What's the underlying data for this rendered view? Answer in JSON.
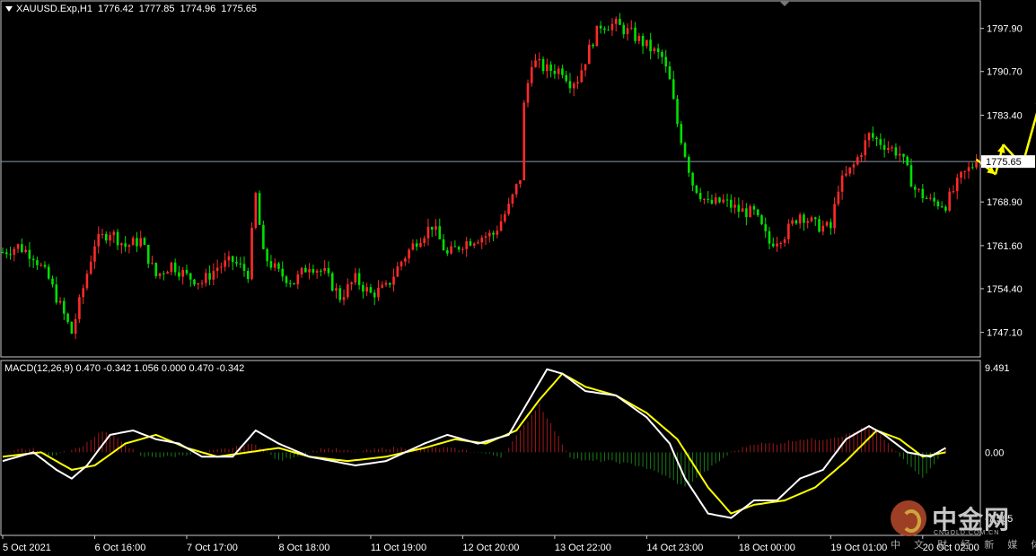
{
  "header": {
    "symbol": "XAUUSD.Exp,H1",
    "open": "1776.42",
    "high": "1777.85",
    "low": "1774.96",
    "close": "1775.65"
  },
  "macd_header": "MACD(12,26,9) 0.470 -0.342 1.056 0.000 0.470 -0.342",
  "current_price_label": "1775.65",
  "watermark": {
    "brand_cn": "中金网",
    "brand_en": "CNGOLD.COM.CN",
    "tagline": "中 文 财 经 新 媒 体"
  },
  "colors": {
    "bull": "#ff2a2a",
    "bear": "#00e000",
    "macd_line": "#ffffff",
    "signal_line": "#ffff00",
    "hist_up": "#a01818",
    "hist_down": "#1a7a1a",
    "arrow": "#ffff00",
    "frame": "#c8c8c8"
  },
  "chart_data": [
    {
      "type": "candlestick",
      "y_ticks": [
        "1797.90",
        "1790.70",
        "1783.40",
        "1775.65",
        "1768.90",
        "1761.60",
        "1754.40",
        "1747.10"
      ],
      "ylim": [
        1743.0,
        1802.5
      ],
      "current_price": 1775.65,
      "x_labels": [
        "5 Oct 2021",
        "6 Oct 16:00",
        "7 Oct 17:00",
        "8 Oct 18:00",
        "11 Oct 19:00",
        "12 Oct 20:00",
        "13 Oct 22:00",
        "14 Oct 23:00",
        "18 Oct 00:00",
        "19 Oct 01:00",
        "20 Oct 02:00"
      ],
      "x_label_bars": [
        0,
        24,
        48,
        72,
        96,
        120,
        144,
        168,
        192,
        216,
        240
      ],
      "close_path": [
        [
          0,
          1760.5
        ],
        [
          4,
          1761.5
        ],
        [
          8,
          1760.0
        ],
        [
          12,
          1756.0
        ],
        [
          16,
          1750.0
        ],
        [
          18,
          1747.0
        ],
        [
          20,
          1752.0
        ],
        [
          24,
          1762.0
        ],
        [
          28,
          1764.0
        ],
        [
          32,
          1761.5
        ],
        [
          36,
          1762.5
        ],
        [
          40,
          1756.5
        ],
        [
          44,
          1758.5
        ],
        [
          48,
          1756.5
        ],
        [
          52,
          1755.5
        ],
        [
          56,
          1758.0
        ],
        [
          60,
          1759.0
        ],
        [
          64,
          1757.0
        ],
        [
          66,
          1770.0
        ],
        [
          68,
          1760.0
        ],
        [
          72,
          1757.0
        ],
        [
          76,
          1755.5
        ],
        [
          80,
          1758.5
        ],
        [
          84,
          1757.0
        ],
        [
          88,
          1753.0
        ],
        [
          92,
          1756.0
        ],
        [
          96,
          1753.5
        ],
        [
          100,
          1754.5
        ],
        [
          104,
          1759.0
        ],
        [
          108,
          1762.5
        ],
        [
          112,
          1765.0
        ],
        [
          116,
          1760.0
        ],
        [
          120,
          1762.0
        ],
        [
          124,
          1763.0
        ],
        [
          128,
          1763.5
        ],
        [
          132,
          1768.0
        ],
        [
          135,
          1773.0
        ],
        [
          136,
          1785.0
        ],
        [
          138,
          1792.5
        ],
        [
          142,
          1791.0
        ],
        [
          146,
          1791.0
        ],
        [
          148,
          1789.0
        ],
        [
          150,
          1789.5
        ],
        [
          154,
          1796.0
        ],
        [
          156,
          1798.5
        ],
        [
          160,
          1798.5
        ],
        [
          164,
          1797.0
        ],
        [
          168,
          1795.0
        ],
        [
          172,
          1793.0
        ],
        [
          174,
          1789.0
        ],
        [
          176,
          1782.0
        ],
        [
          180,
          1772.0
        ],
        [
          184,
          1768.5
        ],
        [
          188,
          1769.0
        ],
        [
          192,
          1767.5
        ],
        [
          196,
          1767.0
        ],
        [
          200,
          1762.0
        ],
        [
          204,
          1763.5
        ],
        [
          208,
          1767.0
        ],
        [
          212,
          1765.0
        ],
        [
          216,
          1764.5
        ],
        [
          218,
          1771.5
        ],
        [
          222,
          1775.0
        ],
        [
          226,
          1780.0
        ],
        [
          230,
          1778.5
        ],
        [
          234,
          1777.0
        ],
        [
          238,
          1771.0
        ],
        [
          242,
          1769.0
        ],
        [
          246,
          1768.5
        ],
        [
          250,
          1773.0
        ],
        [
          254,
          1775.65
        ]
      ],
      "forecast_arrows": [
        {
          "from": [
            1776.0,
            254
          ],
          "to": [
            1773.5,
            259
          ]
        },
        {
          "from": [
            1773.5,
            259
          ],
          "to": [
            1778.5,
            261
          ]
        },
        {
          "from": [
            1778.5,
            261
          ],
          "to": [
            1775.0,
            266
          ]
        },
        {
          "from": [
            1775.0,
            266
          ],
          "to": [
            1786.5,
            271
          ]
        }
      ]
    },
    {
      "type": "macd",
      "name": "MACD(12,26,9)",
      "y_ticks": [
        "9.491",
        "0.00",
        "-7.565"
      ],
      "ylim": [
        -9.5,
        10.5
      ],
      "macd": [
        [
          0,
          -1.0
        ],
        [
          8,
          0
        ],
        [
          14,
          -2.0
        ],
        [
          18,
          -3.0
        ],
        [
          22,
          -1.5
        ],
        [
          28,
          2.0
        ],
        [
          34,
          2.5
        ],
        [
          40,
          1.5
        ],
        [
          46,
          1.0
        ],
        [
          52,
          -0.5
        ],
        [
          60,
          -0.5
        ],
        [
          66,
          2.5
        ],
        [
          72,
          1.0
        ],
        [
          80,
          -0.5
        ],
        [
          86,
          -1.0
        ],
        [
          92,
          -1.5
        ],
        [
          100,
          -1.0
        ],
        [
          110,
          1.0
        ],
        [
          116,
          2.0
        ],
        [
          124,
          1.0
        ],
        [
          132,
          2.0
        ],
        [
          138,
          6.5
        ],
        [
          142,
          9.5
        ],
        [
          146,
          9.0
        ],
        [
          152,
          7.0
        ],
        [
          160,
          6.5
        ],
        [
          168,
          4.0
        ],
        [
          174,
          1.0
        ],
        [
          178,
          -3.0
        ],
        [
          184,
          -7.0
        ],
        [
          190,
          -7.5
        ],
        [
          196,
          -5.5
        ],
        [
          202,
          -5.5
        ],
        [
          208,
          -3.0
        ],
        [
          214,
          -2.0
        ],
        [
          220,
          1.5
        ],
        [
          226,
          3.0
        ],
        [
          230,
          2.0
        ],
        [
          236,
          0
        ],
        [
          242,
          -0.5
        ],
        [
          246,
          0.5
        ]
      ],
      "signal": [
        [
          0,
          -0.5
        ],
        [
          10,
          0
        ],
        [
          18,
          -2.0
        ],
        [
          24,
          -1.5
        ],
        [
          32,
          1.0
        ],
        [
          40,
          2.0
        ],
        [
          48,
          0.5
        ],
        [
          56,
          -0.5
        ],
        [
          64,
          0
        ],
        [
          72,
          0.5
        ],
        [
          80,
          -0.5
        ],
        [
          90,
          -1.0
        ],
        [
          100,
          -0.5
        ],
        [
          110,
          0.5
        ],
        [
          118,
          1.5
        ],
        [
          126,
          1.0
        ],
        [
          134,
          2.5
        ],
        [
          140,
          6.0
        ],
        [
          146,
          9.0
        ],
        [
          152,
          7.5
        ],
        [
          160,
          6.5
        ],
        [
          168,
          4.5
        ],
        [
          176,
          1.5
        ],
        [
          184,
          -4.0
        ],
        [
          190,
          -7.0
        ],
        [
          196,
          -6.0
        ],
        [
          204,
          -5.5
        ],
        [
          212,
          -4.0
        ],
        [
          220,
          -1.0
        ],
        [
          228,
          2.5
        ],
        [
          234,
          1.5
        ],
        [
          240,
          -0.5
        ],
        [
          246,
          0
        ]
      ],
      "histogram": [
        [
          0,
          0
        ],
        [
          8,
          0.5
        ],
        [
          12,
          -0.5
        ],
        [
          20,
          0.5
        ],
        [
          26,
          2.5
        ],
        [
          32,
          1.0
        ],
        [
          36,
          -0.5
        ],
        [
          44,
          -0.5
        ],
        [
          52,
          0
        ],
        [
          60,
          0.5
        ],
        [
          66,
          1.0
        ],
        [
          72,
          -1.0
        ],
        [
          84,
          0.5
        ],
        [
          92,
          0
        ],
        [
          100,
          0.5
        ],
        [
          112,
          0.5
        ],
        [
          116,
          0.5
        ],
        [
          124,
          0
        ],
        [
          130,
          -0.5
        ],
        [
          136,
          3.0
        ],
        [
          140,
          5.5
        ],
        [
          144,
          2.5
        ],
        [
          148,
          -0.5
        ],
        [
          152,
          -1.0
        ],
        [
          158,
          -1.0
        ],
        [
          166,
          -1.5
        ],
        [
          172,
          -2.5
        ],
        [
          178,
          -4.0
        ],
        [
          184,
          -2.0
        ],
        [
          190,
          0
        ],
        [
          196,
          1.0
        ],
        [
          202,
          1.0
        ],
        [
          208,
          1.5
        ],
        [
          214,
          1.5
        ],
        [
          220,
          2.0
        ],
        [
          226,
          3.0
        ],
        [
          230,
          1.5
        ],
        [
          234,
          -0.5
        ],
        [
          240,
          -3.0
        ],
        [
          246,
          0.5
        ]
      ]
    }
  ]
}
